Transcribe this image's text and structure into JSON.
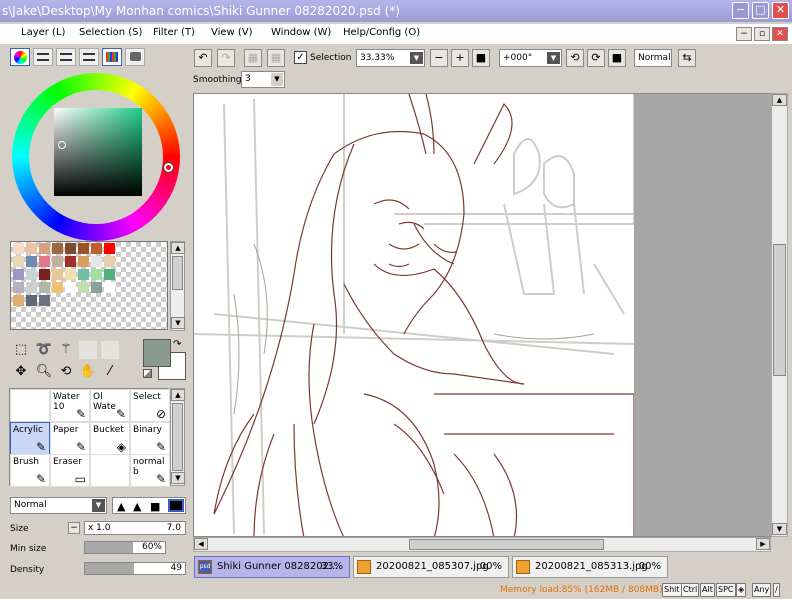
{
  "window": {
    "title": "s\\Jake\\Desktop\\My Monhan comics\\Shiki Gunner 08282020.psd (*)"
  },
  "menubar": {
    "items": [
      "Layer (L)",
      "Selection (S)",
      "Filter (T)",
      "View (V)",
      "Window (W)",
      "Help/Config (O)"
    ]
  },
  "toolbar": {
    "selection_label": "Selection",
    "selection_checked": true,
    "zoom": "33.33%",
    "rotation": "+000°",
    "blend_mode": "Normal",
    "smoothing_label": "Smoothing",
    "smoothing_value": "3"
  },
  "palette": {
    "colors": [
      "#f5dcc8",
      "#e9c3a2",
      "#d7a37e",
      "#a06640",
      "#7c4a2c",
      "#a0512a",
      "#c0602e",
      "#ff0000",
      "#e8d8b8",
      "#6e8baf",
      "#e07a8a",
      "#c0b0a0",
      "#9e3030",
      "#d8a060",
      "#e6e6e6",
      "#e6d0b0",
      "#9b96c7",
      "#c2d6d6",
      "#7a2020",
      "#e8c890",
      "#f0e0b0",
      "#6cc0a0",
      "#a0e0a0",
      "#50b080",
      "#b8b0c0",
      "#d0d0d0",
      "#b0b8a8",
      "#f0c070",
      "#ffffff",
      "#c0e0b0",
      "#8aa098",
      "#ffffff",
      "#e0b070",
      "#606878",
      "#707080"
    ]
  },
  "colors": {
    "main": "#8a9a90",
    "sub": "#ffffff"
  },
  "brushes": [
    {
      "label": "",
      "icon": ""
    },
    {
      "label": "Water 10",
      "icon": "✎"
    },
    {
      "label": "Ol Wate",
      "icon": "✎"
    },
    {
      "label": "Select",
      "icon": "⊘"
    },
    {
      "label": "Acrylic",
      "icon": "✎"
    },
    {
      "label": "Paper",
      "icon": "✎"
    },
    {
      "label": "Bucket",
      "icon": "◈"
    },
    {
      "label": "Binary",
      "icon": "✎"
    },
    {
      "label": "Brush",
      "icon": "✎"
    },
    {
      "label": "Eraser",
      "icon": "▭"
    },
    {
      "label": "",
      "icon": ""
    },
    {
      "label": "normal b",
      "icon": "✎"
    }
  ],
  "brush_settings": {
    "blend_mode": "Normal",
    "size_label": "Size",
    "size_multiplier": "x 1.0",
    "size_value": "7.0",
    "min_size_label": "Min size",
    "min_size_value": "60%",
    "min_size_fraction": 0.6,
    "density_label": "Density",
    "density_value": "49",
    "density_fraction": 0.49
  },
  "doc_tabs": [
    {
      "name": "Shiki Gunner 0828202...",
      "zoom": "33%",
      "icon": "psd",
      "active": true
    },
    {
      "name": "20200821_085307.jpg",
      "zoom": "00%",
      "icon": "",
      "active": false
    },
    {
      "name": "20200821_085313.jpg",
      "zoom": "00%",
      "icon": "",
      "active": false
    }
  ],
  "status": {
    "memory": "Memory load:85% (162MB / 808MB)",
    "memory_color": "#e07000",
    "keys": [
      "Shit",
      "Ctrl",
      "Alt",
      "SPC",
      "◈",
      "Any",
      "∕"
    ]
  }
}
